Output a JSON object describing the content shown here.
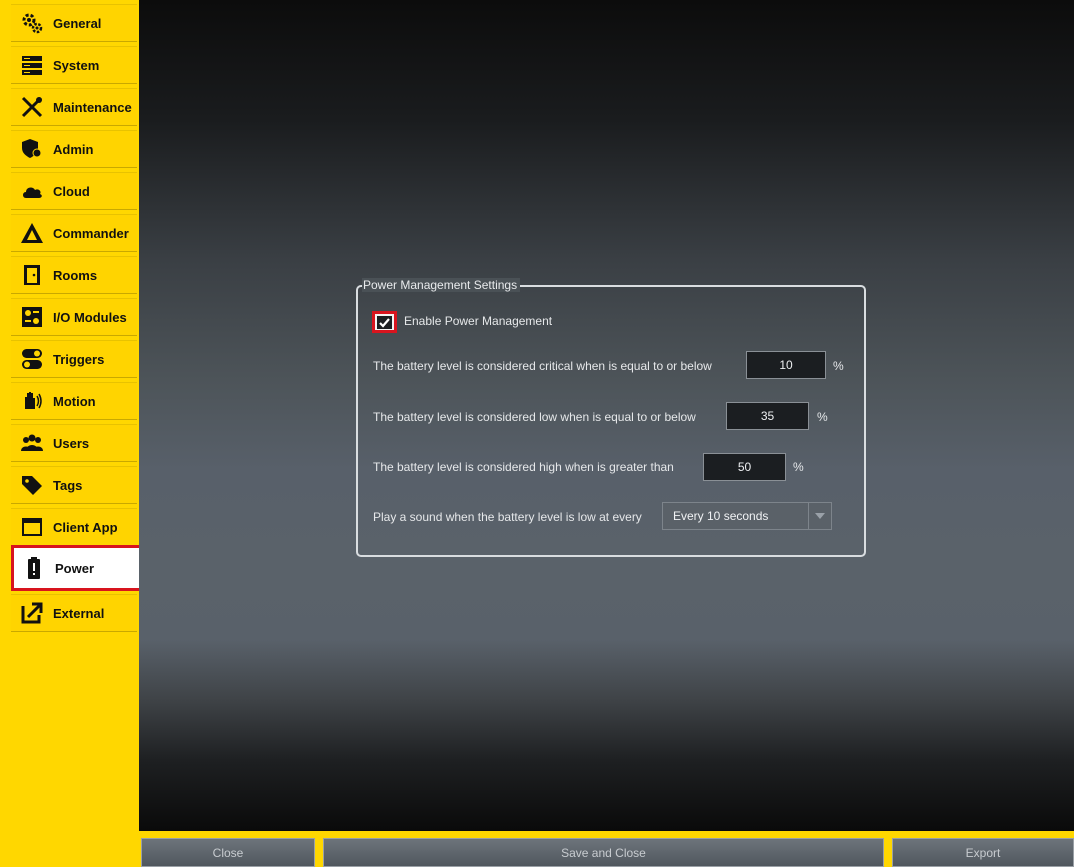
{
  "sidebar": {
    "items": [
      {
        "label": "General",
        "icon": "gears-icon"
      },
      {
        "label": "System",
        "icon": "server-icon"
      },
      {
        "label": "Maintenance",
        "icon": "tools-icon"
      },
      {
        "label": "Admin",
        "icon": "admin-shield-icon"
      },
      {
        "label": "Cloud",
        "icon": "cloud-icon"
      },
      {
        "label": "Commander",
        "icon": "commander-triangle-icon"
      },
      {
        "label": "Rooms",
        "icon": "door-icon"
      },
      {
        "label": "I/O Modules",
        "icon": "io-module-icon"
      },
      {
        "label": "Triggers",
        "icon": "toggle-icon"
      },
      {
        "label": "Motion",
        "icon": "motion-hand-icon"
      },
      {
        "label": "Users",
        "icon": "users-icon"
      },
      {
        "label": "Tags",
        "icon": "tag-icon"
      },
      {
        "label": "Client App",
        "icon": "window-icon"
      },
      {
        "label": "Power",
        "icon": "battery-alert-icon"
      },
      {
        "label": "External",
        "icon": "external-link-icon"
      }
    ],
    "active": "Power"
  },
  "panel": {
    "title": "Power Management Settings",
    "enable_label": "Enable Power Management",
    "enable_checked": true,
    "critical_label": "The battery level is considered critical when is equal to or below",
    "critical_value": "10",
    "low_label": "The battery level is considered low when is equal to or below",
    "low_value": "35",
    "high_label": "The battery level is considered high when is greater than",
    "high_value": "50",
    "percent": "%",
    "sound_label": "Play a sound when the battery level is low at every",
    "sound_value": "Every 10 seconds"
  },
  "buttons": {
    "close": "Close",
    "save_close": "Save and Close",
    "export": "Export"
  },
  "colors": {
    "accent": "#ffd700",
    "highlight": "#d8141e"
  }
}
